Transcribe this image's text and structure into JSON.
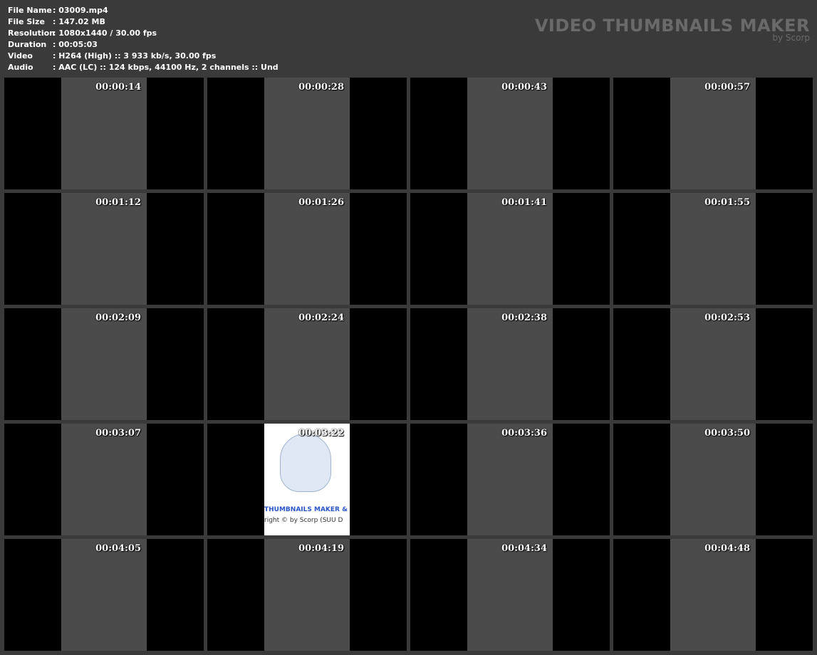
{
  "meta": [
    {
      "label": "File Name",
      "value": ": 03009.mp4"
    },
    {
      "label": "File Size",
      "value": ": 147.02 MB"
    },
    {
      "label": "Resolution",
      "value": ": 1080x1440 / 30.00 fps"
    },
    {
      "label": "Duration",
      "value": ": 00:05:03"
    },
    {
      "label": "Video",
      "value": ": H264 (High) :: 3 933 kb/s, 30.00 fps"
    },
    {
      "label": "Audio",
      "value": ": AAC (LC) :: 124 kbps, 44100 Hz, 2 channels :: Und"
    }
  ],
  "brand": {
    "title": "VIDEO THUMBNAILS MAKER",
    "subtitle": "by Scorp"
  },
  "thumbnails": [
    "00:00:14",
    "00:00:28",
    "00:00:43",
    "00:00:57",
    "00:01:12",
    "00:01:26",
    "00:01:41",
    "00:01:55",
    "00:02:09",
    "00:02:24",
    "00:02:38",
    "00:02:53",
    "00:03:07",
    "00:03:22",
    "00:03:36",
    "00:03:50",
    "00:04:05",
    "00:04:19",
    "00:04:34",
    "00:04:48"
  ],
  "logo_frame": {
    "index": 13,
    "line1": "THUMBNAILS MAKER & A",
    "line2": "right © by Scorp (SUU D"
  }
}
